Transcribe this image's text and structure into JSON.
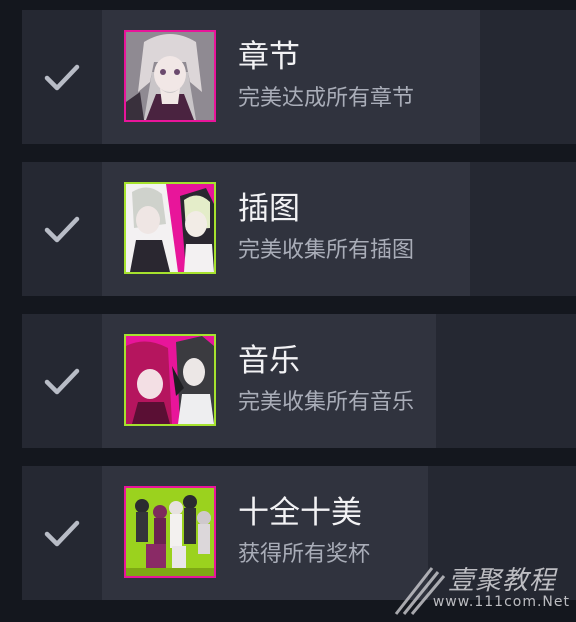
{
  "achievements": [
    {
      "title": "章节",
      "subtitle": "完美达成所有章节",
      "checked": true,
      "thumb_icon": "chapter-art-icon",
      "thumb_bg": "#b9b4b8"
    },
    {
      "title": "插图",
      "subtitle": "完美收集所有插图",
      "checked": true,
      "thumb_icon": "illustration-art-icon",
      "thumb_bg": "#e8159a"
    },
    {
      "title": "音乐",
      "subtitle": "完美收集所有音乐",
      "checked": true,
      "thumb_icon": "music-art-icon",
      "thumb_bg": "#e8159a"
    },
    {
      "title": "十全十美",
      "subtitle": "获得所有奖杯",
      "checked": true,
      "thumb_icon": "perfect-art-icon",
      "thumb_bg": "#9bd21e"
    }
  ],
  "watermark": {
    "name": "壹聚教程",
    "url": "www.111com.Net"
  },
  "colors": {
    "accent": "#e8159a",
    "accent_green": "#a6e22e",
    "check": "#b8bcc6"
  }
}
